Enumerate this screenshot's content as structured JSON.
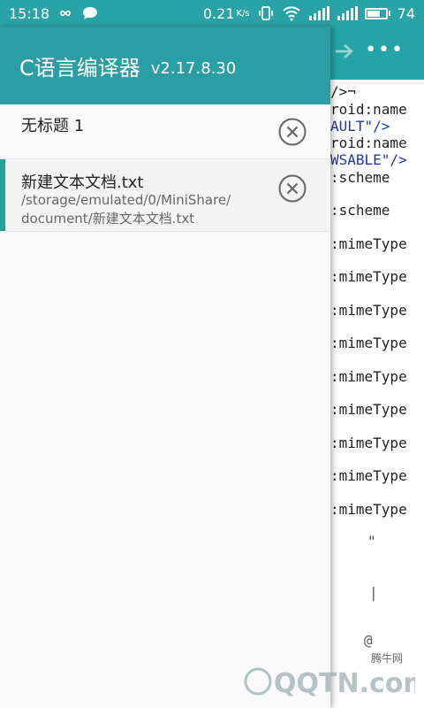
{
  "status_bar": {
    "time": "15:18",
    "net_speed": "0.21",
    "net_unit": "K/s",
    "battery": "74",
    "icons": [
      "infinity-icon",
      "chat-bubble-icon",
      "vibrate-icon",
      "wifi-icon",
      "signal-icon",
      "signal-icon",
      "battery-icon"
    ]
  },
  "drawer": {
    "app_name": "C语言编译器",
    "version": "v2.17.8.30",
    "files": [
      {
        "title": "无标题 1",
        "path": ""
      },
      {
        "title": "新建文本文档.txt",
        "path_line1": "/storage/emulated/0/MiniShare/",
        "path_line2": "document/新建文本文档.txt"
      }
    ]
  },
  "editor": {
    "lines": [
      {
        "text": "roid:name",
        "kw": ""
      },
      {
        "text": "",
        "kw": "AULT\"/>"
      },
      {
        "text": "roid:name",
        "kw": ""
      },
      {
        "text": "",
        "kw": "WSABLE\"/>"
      },
      {
        "text": ":scheme",
        "kw": ""
      },
      {
        "text": ":scheme",
        "kw": ""
      },
      {
        "text": ":mimeType",
        "kw": ""
      },
      {
        "text": ":mimeType",
        "kw": ""
      },
      {
        "text": ":mimeType",
        "kw": ""
      },
      {
        "text": ":mimeType",
        "kw": ""
      },
      {
        "text": ":mimeType",
        "kw": ""
      },
      {
        "text": ":mimeType",
        "kw": ""
      },
      {
        "text": ":mimeType",
        "kw": ""
      },
      {
        "text": ":mimeType",
        "kw": ""
      },
      {
        "text": ":mimeType",
        "kw": ""
      }
    ],
    "first_line": "/>¬",
    "symbols": [
      "\"",
      "|",
      "@"
    ]
  },
  "watermark": {
    "text": "腾牛网",
    "brand": "QQTN.com"
  },
  "colors": {
    "primary": "#2b9ea3",
    "accent": "#22a39a"
  }
}
